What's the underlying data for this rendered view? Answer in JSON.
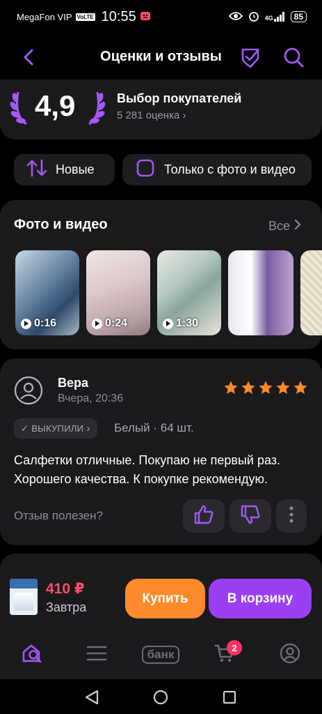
{
  "status": {
    "carrier": "MegaFon VIP",
    "volte": "VoLTE",
    "time": "10:55",
    "network": "4G",
    "battery": "85"
  },
  "header": {
    "title": "Оценки и отзывы"
  },
  "rating": {
    "value": "4,9",
    "choice": "Выбор покупателей",
    "count": "5 281 оценка"
  },
  "filters": {
    "sort_label": "Новые",
    "photo_only_label": "Только с фото и видео"
  },
  "media": {
    "title": "Фото и видео",
    "all_label": "Все",
    "items": [
      {
        "duration": "0:16"
      },
      {
        "duration": "0:24"
      },
      {
        "duration": "1:30"
      },
      {
        "duration": ""
      },
      {
        "duration": ""
      }
    ]
  },
  "review": {
    "author": "Вера",
    "date": "Вчера, 20:36",
    "stars": 5,
    "bought_label": "ВЫКУПИЛИ",
    "variant": "Белый · 64 шт.",
    "text": "Салфетки отличные. Покупаю  не первый раз. Хорошего качества. К покупке рекомендую.",
    "helpful_label": "Отзыв полезен?"
  },
  "buy_bar": {
    "price": "410 ₽",
    "delivery": "Завтра",
    "buy_label": "Купить",
    "cart_label": "В корзину"
  },
  "tabbar": {
    "bank_label": "банк",
    "cart_badge": "2"
  },
  "colors": {
    "accent": "#9b3ff2",
    "star": "#ff8a2b",
    "price": "#ff4d6d",
    "card": "#1a1a1c"
  }
}
